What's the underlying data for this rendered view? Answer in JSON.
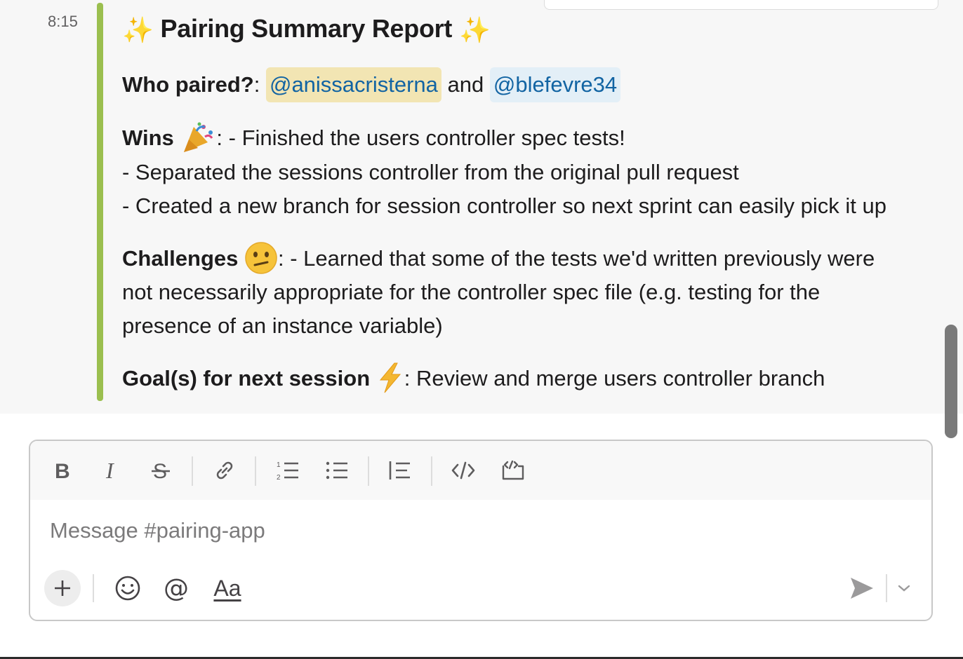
{
  "message": {
    "timestamp": "8:15",
    "title_text": "Pairing Summary Report",
    "title_sparkle": "✨",
    "who_label": "Who paired?",
    "who_colon": ":",
    "mention_1": "@anissacristerna",
    "and_word": "and",
    "mention_2": "@blefevre34",
    "wins_label": "Wins",
    "wins_first": ": - Finished the users controller spec tests!",
    "wins_line_2": "- Separated the sessions controller from the original pull request",
    "wins_line_3": "- Created a new branch for session controller so next sprint can easily pick it up",
    "challenges_label": "Challenges",
    "challenges_line_1": ": - Learned that some of the tests we'd written previously were",
    "challenges_line_2": "not necessarily appropriate for the controller spec file (e.g. testing for the",
    "challenges_line_3": "presence of an instance variable)",
    "goals_label": "Goal(s) for next session",
    "goals_text": ": Review and merge users controller branch",
    "emojis": {
      "wins": "party-popper",
      "challenges": "confused-face",
      "goals": "high-voltage"
    }
  },
  "composer": {
    "placeholder": "Message #pairing-app",
    "format_label": "Aa"
  },
  "toolbar_icons": [
    "bold",
    "italic",
    "strikethrough",
    "link",
    "ordered-list",
    "bulleted-list",
    "blockquote",
    "code",
    "code-block"
  ],
  "colors": {
    "attachment_bar": "#9bbf4f",
    "mention_self_bg": "#f2e5b3",
    "mention_other_bg": "#e3eff7",
    "mention_text": "#1264a3"
  }
}
